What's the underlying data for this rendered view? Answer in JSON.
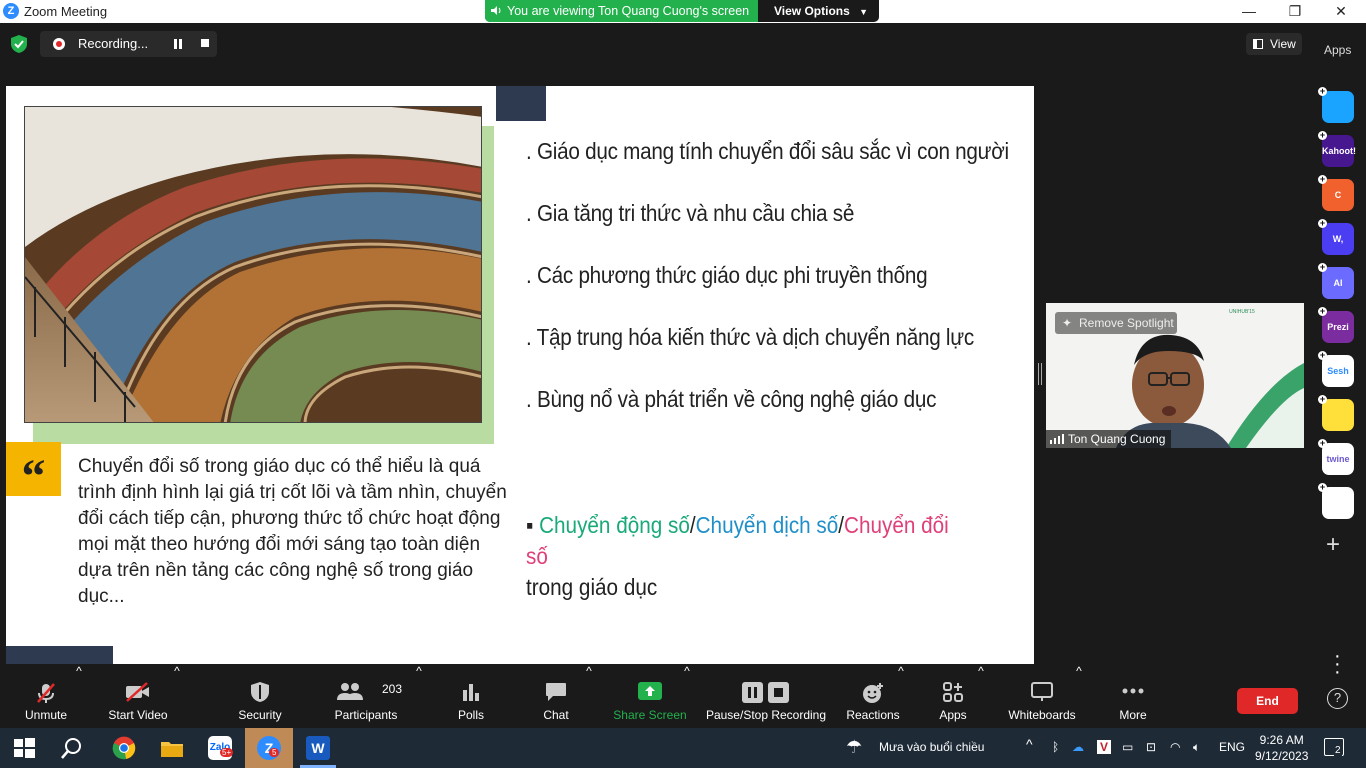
{
  "window": {
    "title": "Zoom Meeting",
    "minimize": "—",
    "maximize": "❐",
    "close": "✕"
  },
  "share_banner": {
    "text": "You are viewing Ton Quang Cuong's screen",
    "view_options": "View Options"
  },
  "recording": {
    "label": "Recording..."
  },
  "view_button": "View",
  "slide": {
    "bullets": [
      ". Giáo dục mang tính chuyển đổi sâu sắc vì con người",
      ". Gia tăng tri thức và nhu cầu chia sẻ",
      ". Các phương thức giáo dục phi truyền thống",
      ". Tập trung hóa kiến thức và dịch chuyển năng lực",
      ". Bùng nổ và phát triển về công nghệ giáo dục"
    ],
    "quote_mark": "“",
    "quote_text": "Chuyển đổi số trong giáo dục có thể hiểu là quá trình định hình lại giá trị cốt lõi và tầm nhìn, chuyển đổi cách tiếp cận, phương thức tổ chức hoạt động mọi mặt theo hướng đổi mới sáng tạo toàn diện dựa trên nền tảng các công nghệ số trong giáo dục...",
    "digital": {
      "marker": "▪ ",
      "part1": "Chuyển động số",
      "sep1": "/",
      "part2": "Chuyển dịch số",
      "sep2": "/",
      "part3": "Chuyển đổi số",
      "rest": "trong giáo dục",
      "colors": {
        "part1": "#19a97b",
        "part2": "#1f8fc9",
        "part3": "#e0407a"
      }
    }
  },
  "video": {
    "remove_spotlight": "Remove Spotlight",
    "participant_name": "Ton Quang Cuong",
    "banner": "UNIHUB'15"
  },
  "apps_panel": {
    "header": "Apps",
    "apps": [
      {
        "name": "Flip",
        "label": "",
        "color": "#1aa3ff"
      },
      {
        "name": "Kahoot",
        "label": "Kahoot!",
        "color": "#46178f"
      },
      {
        "name": "Crowdpurr",
        "label": "C",
        "color": "#f0612e"
      },
      {
        "name": "Wooclap",
        "label": "W,",
        "color": "#4a3df2"
      },
      {
        "name": "AI app",
        "label": "AI",
        "color": "#6b6bff"
      },
      {
        "name": "Prezi",
        "label": "Prezi",
        "color": "#7b2c9e"
      },
      {
        "name": "Sesh",
        "label": "Sesh",
        "color": "#ffffff"
      },
      {
        "name": "Emoji app",
        "label": "",
        "color": "#ffe03a"
      },
      {
        "name": "Twine",
        "label": "twine",
        "color": "#ffffff"
      },
      {
        "name": "Blocks app",
        "label": "",
        "color": "#ffffff"
      }
    ]
  },
  "toolbar": {
    "unmute": "Unmute",
    "start_video": "Start Video",
    "security": "Security",
    "participants": "Participants",
    "participants_count": "203",
    "polls": "Polls",
    "chat": "Chat",
    "share_screen": "Share Screen",
    "pause_stop_recording": "Pause/Stop Recording",
    "reactions": "Reactions",
    "apps": "Apps",
    "whiteboards": "Whiteboards",
    "more": "More",
    "end": "End"
  },
  "taskbar": {
    "weather": "Mưa vào buổi chiều",
    "language": "ENG",
    "time": "9:26 AM",
    "date": "9/12/2023",
    "notifications": "2",
    "zalo_badge": "5+",
    "zoom_badge": "5"
  },
  "colors": {
    "accent_green": "#23b14d",
    "end_red": "#e02828",
    "share_green": "#23b14d"
  }
}
